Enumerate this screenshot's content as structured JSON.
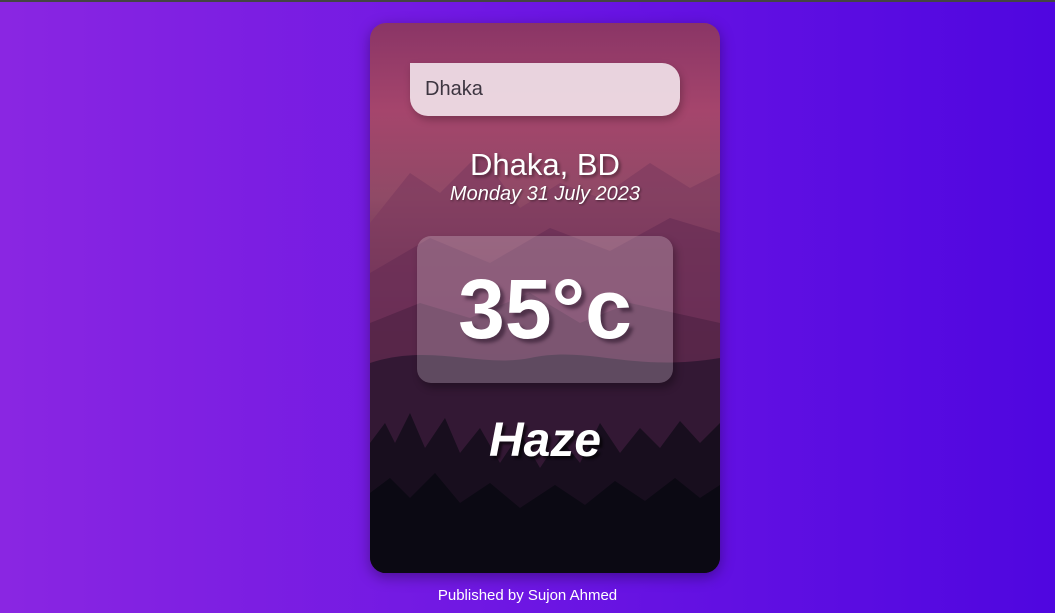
{
  "search": {
    "value": "Dhaka"
  },
  "location": {
    "city_country": "Dhaka, BD",
    "date": "Monday 31 July 2023"
  },
  "weather": {
    "temperature": "35°c",
    "condition": "Haze"
  },
  "footer": {
    "credit": "Published by Sujon Ahmed"
  },
  "colors": {
    "background_start": "#8a26e2",
    "background_end": "#4f06e0",
    "text": "#ffffff"
  }
}
